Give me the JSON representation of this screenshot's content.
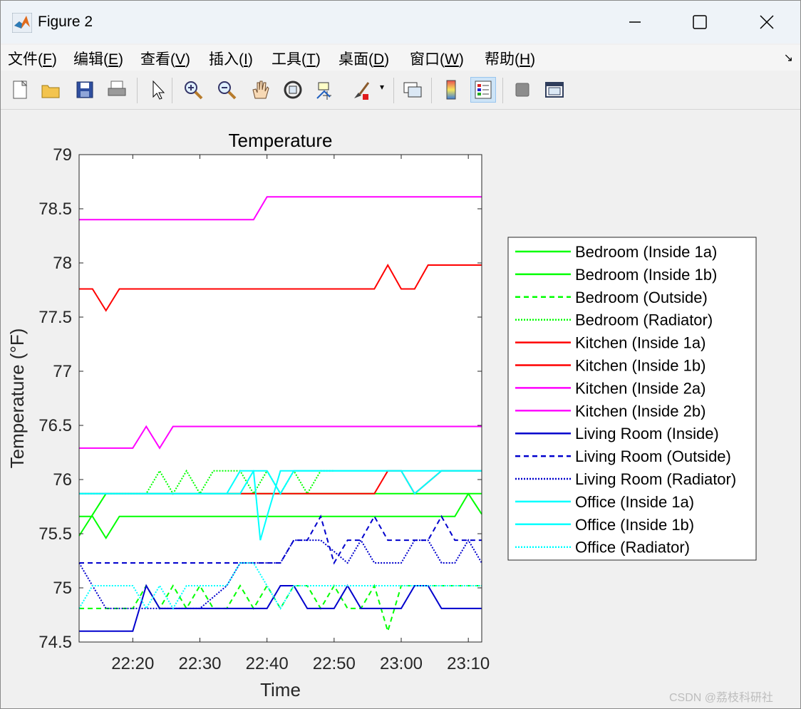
{
  "window": {
    "title": "Figure 2",
    "watermark": "CSDN @荔枝科研社"
  },
  "menu": [
    {
      "label": "文件(",
      "key": "F",
      "end": ")"
    },
    {
      "label": "编辑(",
      "key": "E",
      "end": ")"
    },
    {
      "label": "查看(",
      "key": "V",
      "end": ")"
    },
    {
      "label": "插入(",
      "key": "I",
      "end": ")"
    },
    {
      "label": "工具(",
      "key": "T",
      "end": ")"
    },
    {
      "label": "桌面(",
      "key": "D",
      "end": ")"
    },
    {
      "label": "窗口(",
      "key": "W",
      "end": ")"
    },
    {
      "label": "帮助(",
      "key": "H",
      "end": ")"
    }
  ],
  "toolbar_icons": [
    "new-figure-icon",
    "open-file-icon",
    "save-icon",
    "print-icon",
    "edit-plot-icon",
    "zoom-in-icon",
    "zoom-out-icon",
    "pan-icon",
    "rotate-3d-icon",
    "data-cursor-icon",
    "brush-icon",
    "link-plot-icon",
    "colorbar-icon",
    "legend-icon",
    "hide-plot-tools-icon",
    "show-plot-tools-icon"
  ],
  "chart_data": {
    "type": "line",
    "title": "Temperature",
    "xlabel": "Time",
    "ylabel": "Temperature (°F)",
    "xlim": [
      1332,
      1392
    ],
    "ylim": [
      74.5,
      79
    ],
    "xticks": [
      1340,
      1350,
      1360,
      1370,
      1380,
      1390
    ],
    "xticklabels": [
      "22:20",
      "22:30",
      "22:40",
      "22:50",
      "23:00",
      "23:10"
    ],
    "yticks": [
      74.5,
      75,
      75.5,
      76,
      76.5,
      77,
      77.5,
      78,
      78.5,
      79
    ],
    "yticklabels": [
      "74.5",
      "75",
      "75.5",
      "76",
      "76.5",
      "77",
      "77.5",
      "78",
      "78.5",
      "79"
    ],
    "legend_position": "outside-right",
    "grid": false,
    "series": [
      {
        "name": "Bedroom (Inside 1a)",
        "color": "#00ff00",
        "style": "solid",
        "x": [
          1332,
          1336,
          1338,
          1340,
          1342,
          1354,
          1356,
          1358,
          1362,
          1364,
          1388,
          1390,
          1392
        ],
        "y": [
          75.48,
          75.87,
          75.87,
          75.87,
          75.87,
          75.87,
          75.87,
          75.87,
          75.87,
          75.87,
          75.87,
          75.87,
          75.68
        ]
      },
      {
        "name": "Bedroom (Inside 1b)",
        "color": "#00ff00",
        "style": "solid",
        "x": [
          1332,
          1334,
          1336,
          1338,
          1340,
          1352,
          1354,
          1356,
          1362,
          1364,
          1372,
          1374,
          1376,
          1380,
          1382,
          1388,
          1390,
          1392
        ],
        "y": [
          75.66,
          75.66,
          75.46,
          75.66,
          75.66,
          75.66,
          75.66,
          75.66,
          75.66,
          75.66,
          75.66,
          75.66,
          75.66,
          75.66,
          75.66,
          75.66,
          75.87,
          75.87
        ]
      },
      {
        "name": "Bedroom (Outside)",
        "color": "#00ff00",
        "style": "dashed",
        "x": [
          1332,
          1338,
          1340,
          1342,
          1344,
          1346,
          1348,
          1350,
          1352,
          1354,
          1356,
          1358,
          1360,
          1362,
          1364,
          1366,
          1368,
          1370,
          1372,
          1374,
          1376,
          1378,
          1380,
          1382,
          1384,
          1392
        ],
        "y": [
          74.81,
          74.81,
          74.81,
          75.02,
          74.81,
          75.02,
          74.81,
          75.02,
          74.81,
          74.81,
          75.02,
          74.81,
          75.02,
          74.81,
          75.02,
          75.02,
          74.81,
          75.02,
          74.81,
          74.81,
          75.02,
          74.6,
          75.02,
          75.02,
          75.02,
          75.02
        ]
      },
      {
        "name": "Bedroom (Radiator)",
        "color": "#00ff00",
        "style": "dotted",
        "x": [
          1332,
          1340,
          1342,
          1344,
          1346,
          1348,
          1350,
          1352,
          1354,
          1356,
          1358,
          1360,
          1362,
          1364,
          1366,
          1368,
          1370
        ],
        "y": [
          75.87,
          75.87,
          75.87,
          76.08,
          75.87,
          76.08,
          75.87,
          76.08,
          76.08,
          76.08,
          75.87,
          76.08,
          75.87,
          76.08,
          75.87,
          76.08,
          76.08
        ]
      },
      {
        "name": "Kitchen (Inside 1a)",
        "color": "#ff0000",
        "style": "solid",
        "x": [
          1332,
          1334,
          1336,
          1338,
          1340,
          1374,
          1376,
          1378,
          1380,
          1382,
          1384,
          1392
        ],
        "y": [
          77.76,
          77.76,
          77.56,
          77.76,
          77.76,
          77.76,
          77.76,
          77.98,
          77.76,
          77.76,
          77.98,
          77.98
        ]
      },
      {
        "name": "Kitchen (Inside 1b)",
        "color": "#ff0000",
        "style": "solid",
        "x": [
          1332,
          1354,
          1356,
          1376,
          1378,
          1380,
          1382,
          1386,
          1392
        ],
        "y": [
          75.87,
          75.87,
          75.87,
          75.87,
          76.08,
          76.08,
          75.87,
          76.08,
          76.08
        ]
      },
      {
        "name": "Kitchen (Inside 2a)",
        "color": "#ff00ff",
        "style": "solid",
        "x": [
          1332,
          1356,
          1358,
          1360,
          1392
        ],
        "y": [
          78.4,
          78.4,
          78.4,
          78.61,
          78.61
        ]
      },
      {
        "name": "Kitchen (Inside 2b)",
        "color": "#ff00ff",
        "style": "solid",
        "x": [
          1332,
          1340,
          1342,
          1344,
          1346,
          1392
        ],
        "y": [
          76.29,
          76.29,
          76.49,
          76.29,
          76.49,
          76.49
        ]
      },
      {
        "name": "Living Room (Inside)",
        "color": "#0000cd",
        "style": "solid",
        "x": [
          1332,
          1338,
          1340,
          1342,
          1344,
          1356,
          1358,
          1360,
          1362,
          1364,
          1366,
          1370,
          1372,
          1374,
          1376,
          1380,
          1382,
          1384,
          1386,
          1392
        ],
        "y": [
          74.6,
          74.6,
          74.6,
          75.02,
          74.81,
          74.81,
          74.81,
          74.81,
          75.02,
          75.02,
          74.81,
          74.81,
          75.02,
          74.81,
          74.81,
          74.81,
          75.02,
          75.02,
          74.81,
          74.81
        ]
      },
      {
        "name": "Living Room (Outside)",
        "color": "#0000cd",
        "style": "dashed",
        "x": [
          1332,
          1360,
          1362,
          1364,
          1366,
          1368,
          1370,
          1372,
          1374,
          1376,
          1378,
          1380,
          1382,
          1384,
          1386,
          1388,
          1390,
          1392
        ],
        "y": [
          75.23,
          75.23,
          75.23,
          75.44,
          75.44,
          75.66,
          75.23,
          75.44,
          75.44,
          75.66,
          75.44,
          75.44,
          75.44,
          75.44,
          75.66,
          75.44,
          75.44,
          75.44
        ]
      },
      {
        "name": "Living Room (Radiator)",
        "color": "#0000cd",
        "style": "dotted",
        "x": [
          1332,
          1334,
          1336,
          1346,
          1348,
          1350,
          1354,
          1356,
          1358,
          1360,
          1362,
          1364,
          1366,
          1368,
          1372,
          1374,
          1376,
          1378,
          1380,
          1382,
          1384,
          1386,
          1388,
          1390,
          1392
        ],
        "y": [
          75.23,
          75.02,
          74.81,
          74.81,
          74.81,
          74.81,
          75.02,
          75.23,
          75.23,
          75.23,
          75.23,
          75.44,
          75.44,
          75.44,
          75.23,
          75.44,
          75.23,
          75.23,
          75.23,
          75.44,
          75.44,
          75.23,
          75.23,
          75.44,
          75.23
        ]
      },
      {
        "name": "Office (Inside 1a)",
        "color": "#00ffff",
        "style": "solid",
        "x": [
          1332,
          1334,
          1354,
          1356,
          1358,
          1360,
          1362,
          1364,
          1366,
          1374,
          1376,
          1380,
          1382,
          1386,
          1392
        ],
        "y": [
          75.87,
          75.87,
          75.87,
          75.87,
          76.08,
          76.08,
          75.87,
          76.08,
          76.08,
          76.08,
          76.08,
          76.08,
          75.87,
          76.08,
          76.08
        ]
      },
      {
        "name": "Office (Inside 1b)",
        "color": "#00ffff",
        "style": "solid",
        "x": [
          1332,
          1354,
          1356,
          1358,
          1359,
          1360,
          1362,
          1368,
          1370,
          1372,
          1392
        ],
        "y": [
          75.87,
          75.87,
          76.08,
          76.08,
          75.44,
          75.66,
          76.08,
          76.08,
          76.08,
          76.08,
          76.08
        ]
      },
      {
        "name": "Office (Radiator)",
        "color": "#00ffff",
        "style": "dotted",
        "x": [
          1332,
          1334,
          1340,
          1342,
          1344,
          1346,
          1348,
          1354,
          1356,
          1358,
          1360,
          1362,
          1364,
          1392
        ],
        "y": [
          74.81,
          75.02,
          75.02,
          74.81,
          75.02,
          74.81,
          75.02,
          75.02,
          75.23,
          75.23,
          75.02,
          74.81,
          75.02,
          75.02
        ]
      }
    ]
  }
}
